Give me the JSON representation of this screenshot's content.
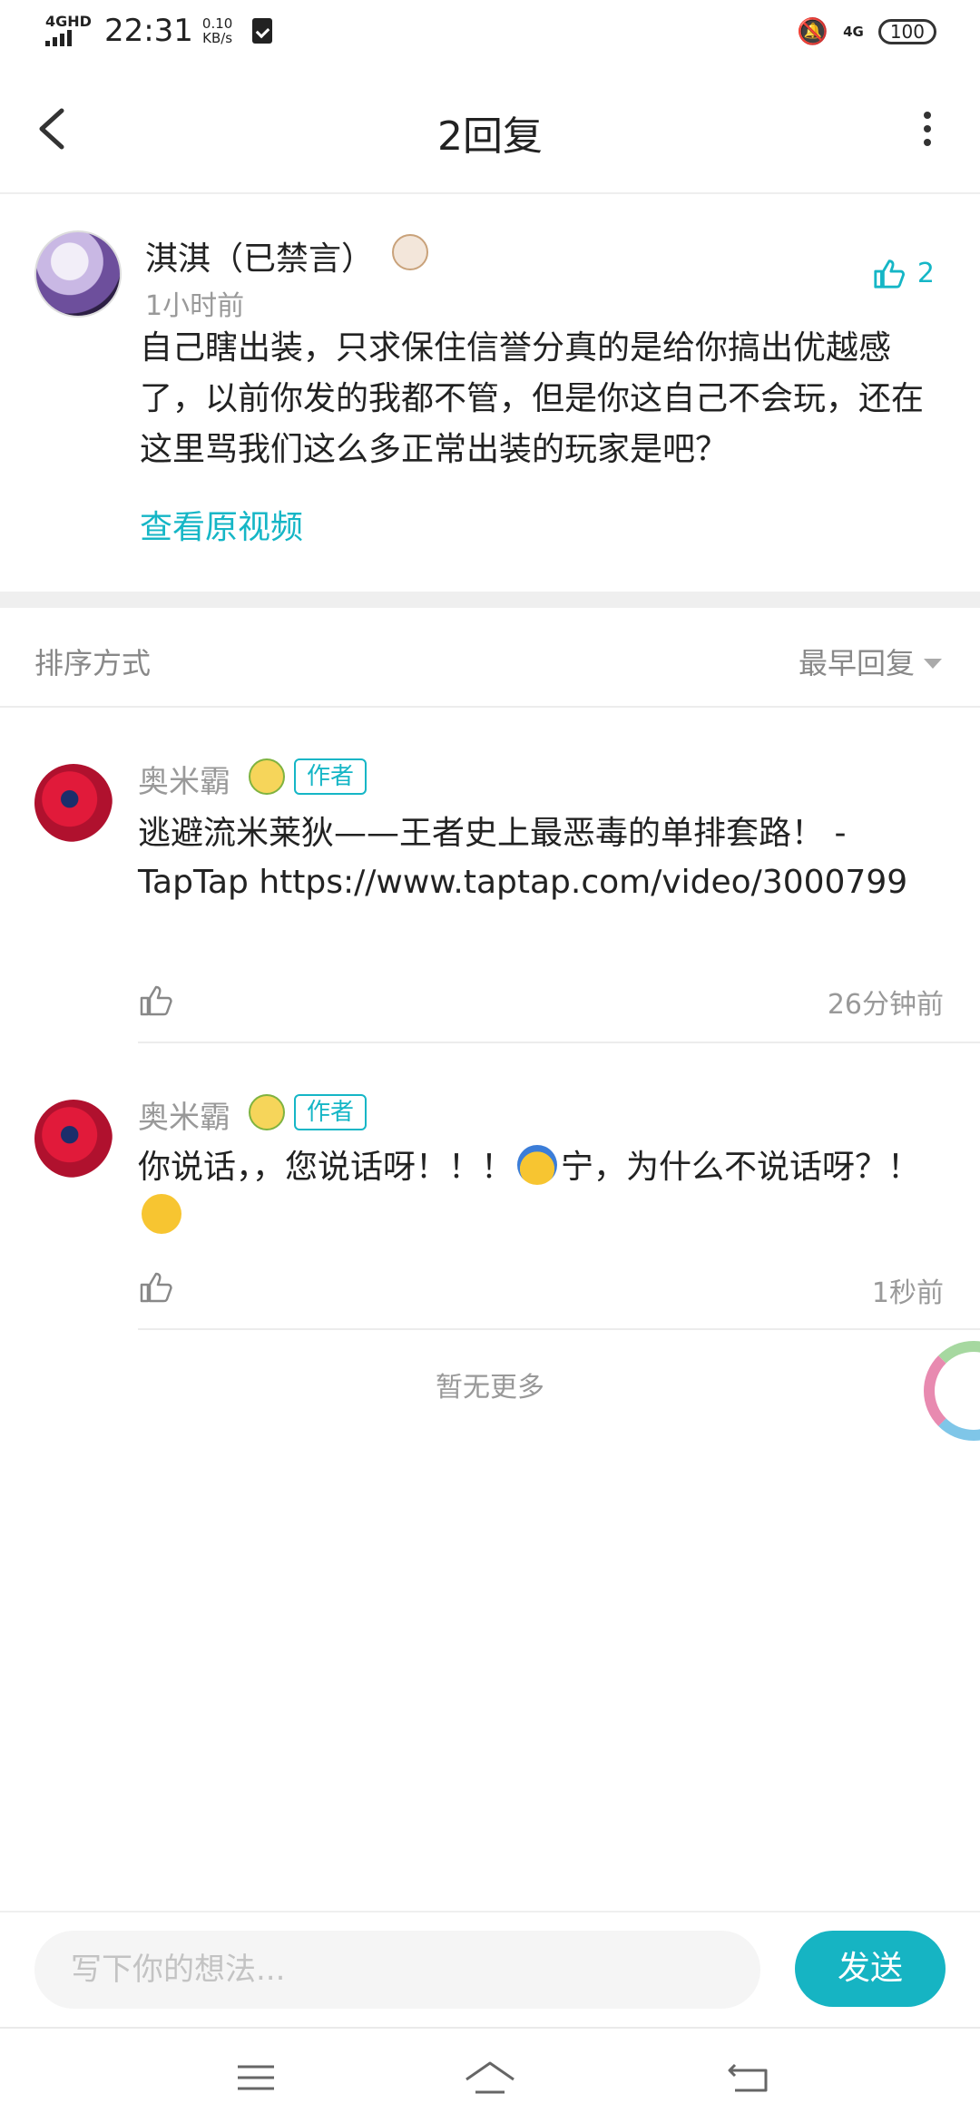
{
  "status_bar": {
    "network": "4GHD",
    "time": "22:31",
    "speed_value": "0.10",
    "speed_unit": "KB/s",
    "network_right": "4G",
    "battery": "100"
  },
  "header": {
    "title": "2回复"
  },
  "main_comment": {
    "author": "淇淇（已禁言）",
    "time": "1小时前",
    "like_count": "2",
    "text": "自己瞎出装，只求保住信誉分真的是给你搞出优越感了，以前你发的我都不管，但是你这自己不会玩，还在这里骂我们这么多正常出装的玩家是吧？",
    "link": "查看原视频"
  },
  "sort": {
    "label": "排序方式",
    "selected": "最早回复"
  },
  "replies": [
    {
      "author": "奥米霸",
      "badge": "作者",
      "text": "逃避流米莱狄——王者史上最恶毒的单排套路！ - TapTap https://www.taptap.com/video/3000799",
      "time": "26分钟前"
    },
    {
      "author": "奥米霸",
      "badge": "作者",
      "text_part1": "你说话，，您说话呀！！！",
      "text_part2": "宁，为什么不说话呀？！",
      "time": "1秒前"
    }
  ],
  "no_more": "暂无更多",
  "input": {
    "placeholder": "写下你的想法...",
    "send_label": "发送"
  },
  "colors": {
    "accent": "#16b4c3",
    "secondary_text": "#999999"
  }
}
